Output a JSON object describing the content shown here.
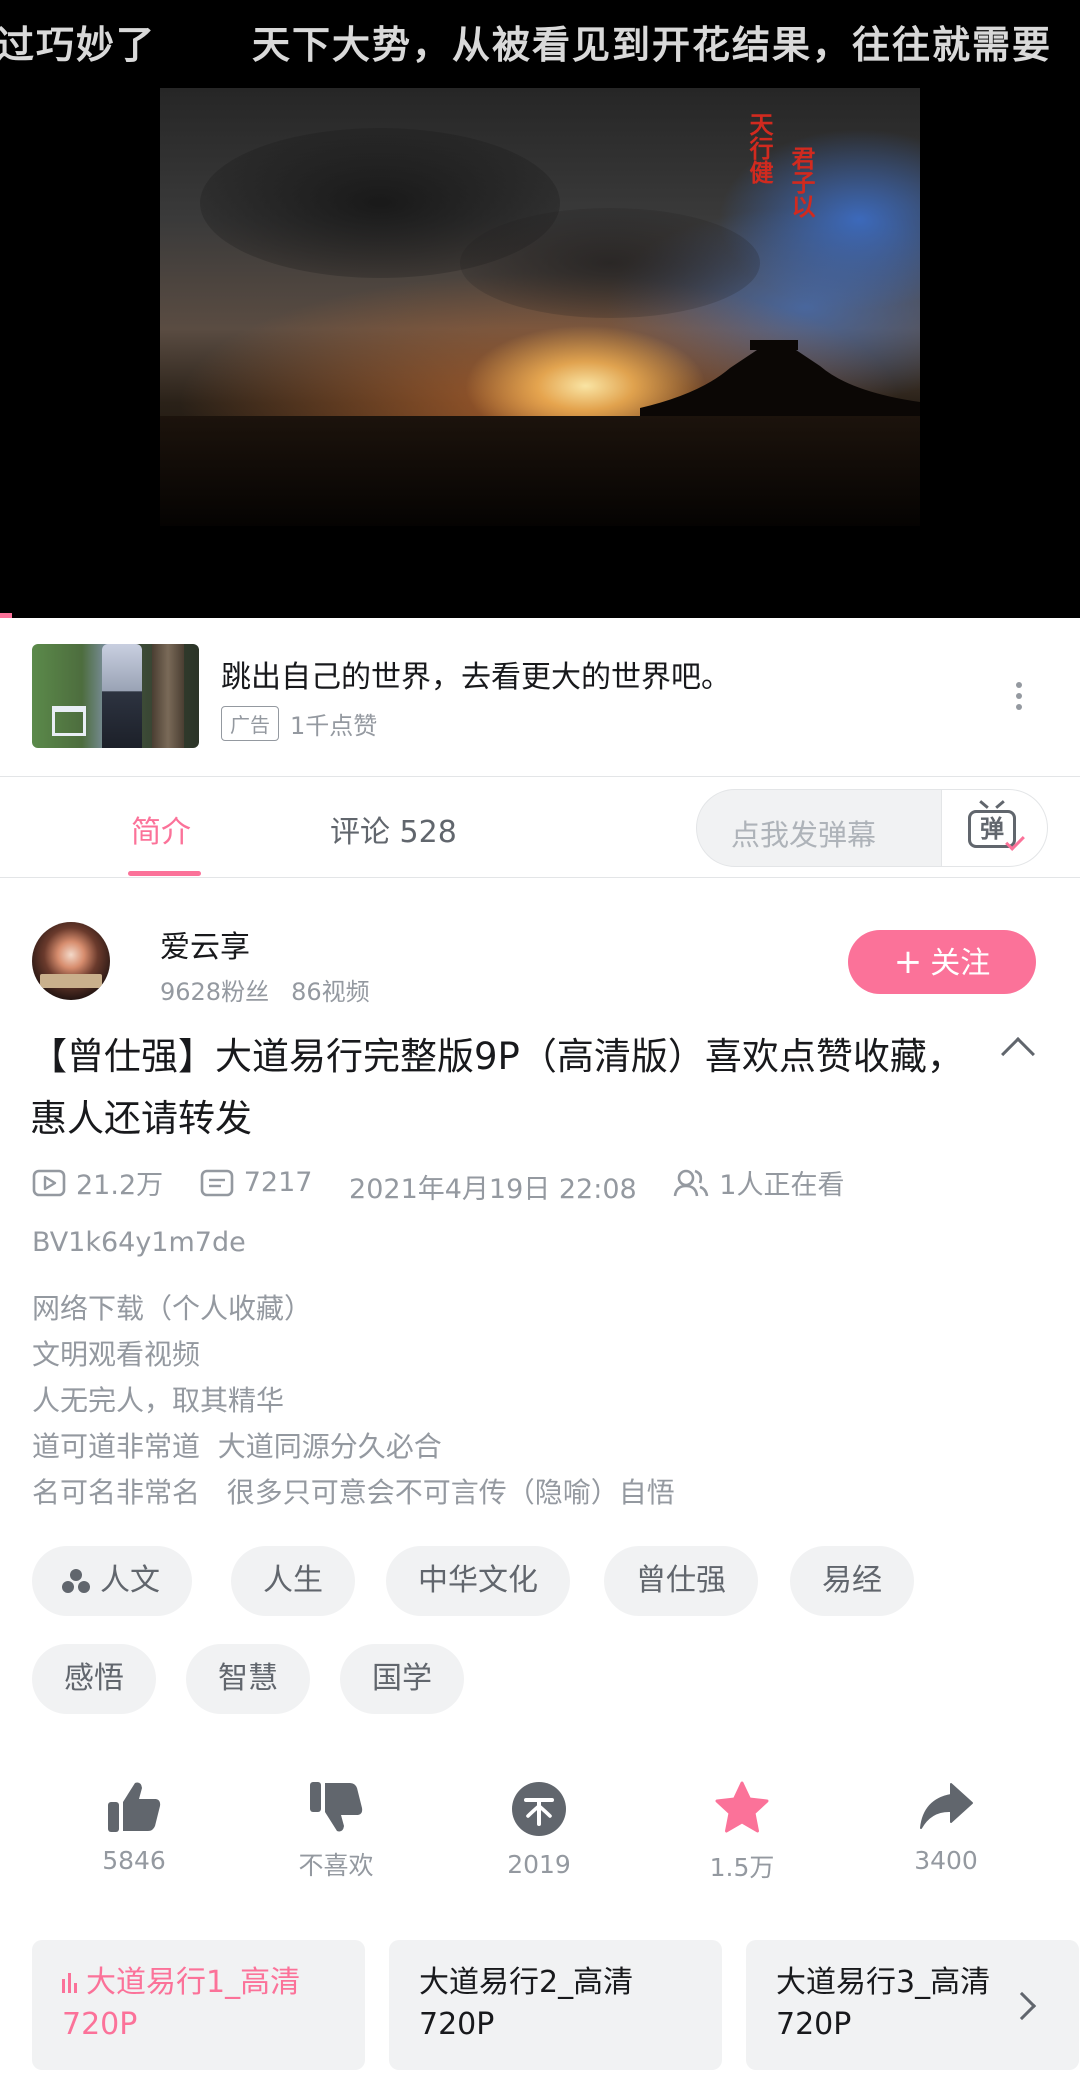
{
  "player": {
    "danmaku_scroll": [
      "过巧妙了",
      "天下大势，从被看见到开花结果，往往就需要"
    ],
    "calligraphy": [
      "天行健",
      "君子以"
    ]
  },
  "ad": {
    "title": "跳出自己的世界，去看更大的世界吧。",
    "badge": "广告",
    "likes": "1千点赞"
  },
  "tabs": {
    "intro": "简介",
    "comments": "评论 528",
    "danmaku_placeholder": "点我发弹幕",
    "danmaku_icon_char": "弹"
  },
  "uploader": {
    "name": "爱云享",
    "fans": "9628粉丝",
    "videos": "86视频",
    "follow_label": "关注"
  },
  "video": {
    "title": "【曾仕强】大道易行完整版9P（高清版）喜欢点赞收藏，惠人还请转发",
    "views": "21.2万",
    "danmaku_count": "7217",
    "date": "2021年4月19日 22:08",
    "watching": "1人正在看",
    "bvid": "BV1k64y1m7de",
    "description": "网络下载（个人收藏）\n文明观看视频\n人无完人，取其精华\n道可道非常道  大道同源分久必合\n名可名非常名   很多只可意会不可言传（隐喻）自悟"
  },
  "tags": [
    "人文",
    "人生",
    "中华文化",
    "曾仕强",
    "易经",
    "感悟",
    "智慧",
    "国学"
  ],
  "actions": {
    "like": "5846",
    "dislike": "不喜欢",
    "coin": "2019",
    "favorite": "1.5万",
    "share": "3400"
  },
  "episodes": [
    {
      "title": "大道易行1_高清",
      "quality": "720P"
    },
    {
      "title": "大道易行2_高清",
      "quality": "720P"
    },
    {
      "title": "大道易行3_高清",
      "quality": "720P"
    }
  ],
  "colors": {
    "accent": "#fb7299",
    "text_primary": "#18191c",
    "text_secondary": "#9499a0",
    "chip_bg": "#f1f2f3"
  }
}
